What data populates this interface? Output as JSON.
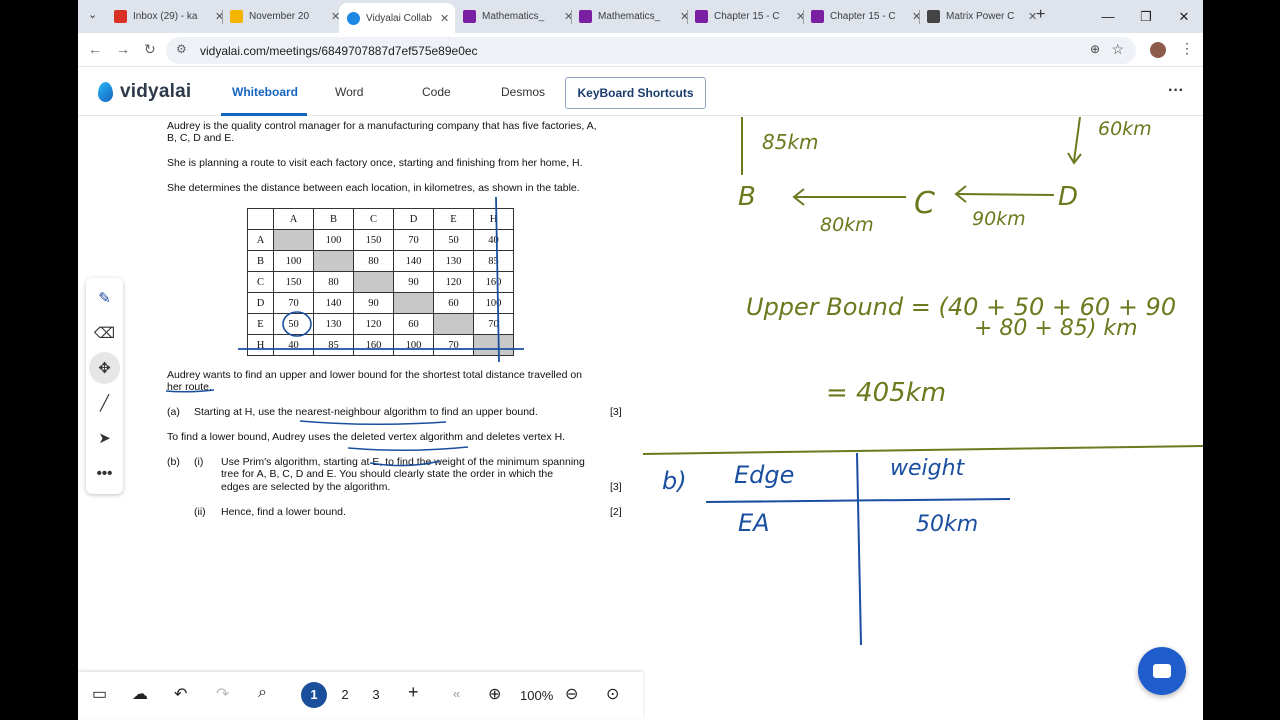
{
  "browser": {
    "tabs": [
      {
        "title": "Inbox (29) - ka",
        "icon": "gmail-icon",
        "color": "#d93025"
      },
      {
        "title": "November 20",
        "icon": "drive-icon",
        "color": "#f4b400"
      },
      {
        "title": "Vidyalai Collab",
        "icon": "vidyalai-icon",
        "color": "#1e88e5",
        "active": true
      },
      {
        "title": "Mathematics_",
        "icon": "book-icon",
        "color": "#7b1fa2"
      },
      {
        "title": "Mathematics_",
        "icon": "book-icon",
        "color": "#7b1fa2"
      },
      {
        "title": "Chapter 15 - C",
        "icon": "book-icon",
        "color": "#7b1fa2"
      },
      {
        "title": "Chapter 15 - C",
        "icon": "book-icon",
        "color": "#7b1fa2"
      },
      {
        "title": "Matrix Power C",
        "icon": "r-icon",
        "color": "#444444"
      }
    ],
    "url": "vidyalai.com/meetings/6849707887d7ef575e89e0ec"
  },
  "app": {
    "logo": "vidyalai",
    "tabs": [
      "Whiteboard",
      "Word",
      "Code",
      "Desmos"
    ],
    "selected_tab": "Whiteboard",
    "keyboard_button": "KeyBoard Shortcuts",
    "accent": "#1565c0"
  },
  "question": {
    "intro1": "Audrey is the quality control manager for a manufacturing company that has five factories, A,",
    "intro1b": "B, C, D and E.",
    "intro2": "She is planning a route to visit each factory once, starting and finishing from her home, H.",
    "intro3": "She determines the distance between each location, in kilometres, as shown in the table.",
    "table": {
      "headers": [
        "",
        "A",
        "B",
        "C",
        "D",
        "E",
        "H"
      ],
      "rows": [
        [
          "A",
          "",
          "100",
          "150",
          "70",
          "50",
          "40"
        ],
        [
          "B",
          "100",
          "",
          "80",
          "140",
          "130",
          "85"
        ],
        [
          "C",
          "150",
          "80",
          "",
          "90",
          "120",
          "160"
        ],
        [
          "D",
          "70",
          "140",
          "90",
          "",
          "60",
          "100"
        ],
        [
          "E",
          "50",
          "130",
          "120",
          "60",
          "",
          "70"
        ],
        [
          "H",
          "40",
          "85",
          "160",
          "100",
          "70",
          ""
        ]
      ]
    },
    "bound1": "Audrey wants to find an upper and lower bound for the shortest total distance travelled on",
    "bound2": "her route.",
    "a_label": "(a)",
    "a_text": "Starting at H, use the nearest-neighbour algorithm to find an upper bound.",
    "a_marks": "[3]",
    "lower": "To find a lower bound, Audrey uses the deleted vertex algorithm and deletes vertex H.",
    "b_label": "(b)",
    "bi_label": "(i)",
    "bi_line1": "Use Prim's algorithm, starting at E, to find the weight of the minimum spanning",
    "bi_line2": "tree for A, B, C, D and E. You should clearly state the order in which the",
    "bi_line3": "edges are selected by the algorithm.",
    "bi_marks": "[3]",
    "bii_label": "(ii)",
    "bii_text": "Hence, find a lower bound.",
    "bii_marks": "[2]"
  },
  "handwriting": {
    "km85": "85km",
    "km60": "60km",
    "B": "B",
    "C": "C",
    "D": "D",
    "km80": "80km",
    "km90": "90km",
    "ub_line1": "Upper Bound = (40 + 50 + 60 + 90",
    "ub_line2": "+ 80 + 85) km",
    "ub_result": "= 405km",
    "b_part": "b)",
    "col_edge": "Edge",
    "col_weight": "weight",
    "row_edge": "EA",
    "row_weight": "50km",
    "ink_color": "#6b7a1e"
  },
  "pages": [
    "1",
    "2",
    "3"
  ],
  "current_page": "1",
  "zoom": "100%"
}
